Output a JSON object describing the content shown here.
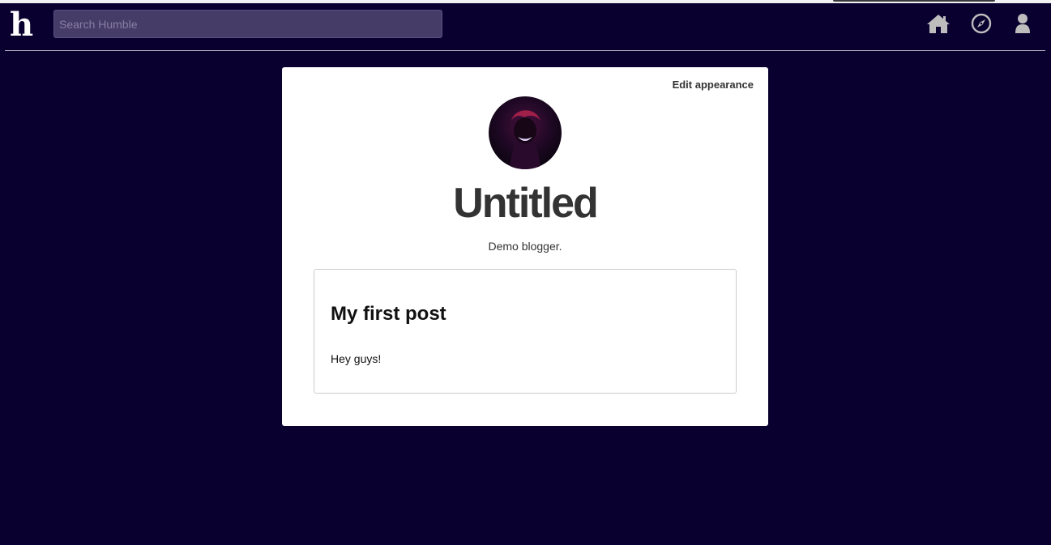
{
  "header": {
    "logo": "h",
    "search": {
      "placeholder": "Search Humble",
      "value": ""
    },
    "icons": [
      "home-icon",
      "compass-icon",
      "user-icon"
    ],
    "colors": {
      "background": "#0a0030",
      "search_bg": "#463c68",
      "icon": "#bdbdbd"
    }
  },
  "blog": {
    "edit_label": "Edit appearance",
    "title": "Untitled",
    "description": "Demo blogger."
  },
  "posts": [
    {
      "title": "My first post",
      "body": "Hey guys!"
    }
  ]
}
